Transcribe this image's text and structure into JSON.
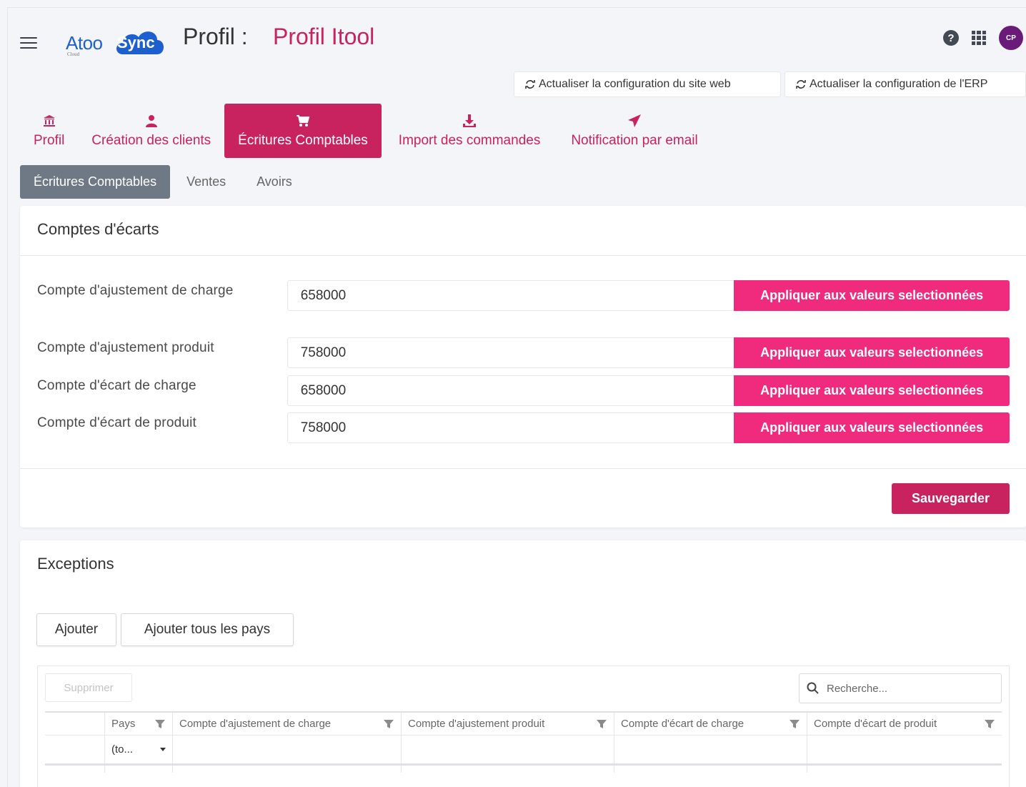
{
  "header": {
    "logo_text_1": "Atoo",
    "logo_text_2": "Sync",
    "logo_small": "Cloud",
    "title_label": "Profil :",
    "title_value": "Profil Itool",
    "avatar_initials": "CP",
    "help_glyph": "?"
  },
  "actions": {
    "refresh_site": "Actualiser la configuration du site web",
    "refresh_erp": "Actualiser la configuration de l'ERP"
  },
  "main_tabs": [
    {
      "label": "Profil",
      "icon": "bank-icon"
    },
    {
      "label": "Création des clients",
      "icon": "user-icon"
    },
    {
      "label": "Écritures Comptables",
      "icon": "cart-icon",
      "active": true
    },
    {
      "label": "Import des commandes",
      "icon": "download-icon"
    },
    {
      "label": "Notification par email",
      "icon": "send-icon"
    }
  ],
  "sub_tabs": [
    {
      "label": "Écritures Comptables",
      "active": true
    },
    {
      "label": "Ventes"
    },
    {
      "label": "Avoirs"
    }
  ],
  "comptes_card": {
    "title": "Comptes d'écarts",
    "rows": [
      {
        "label": "Compte d'ajustement de charge",
        "value": "658000",
        "button": "Appliquer aux valeurs selectionnées"
      },
      {
        "label": "Compte d'ajustement produit",
        "value": "758000",
        "button": "Appliquer aux valeurs selectionnées"
      },
      {
        "label": "Compte d'écart de charge",
        "value": "658000",
        "button": "Appliquer aux valeurs selectionnées"
      },
      {
        "label": "Compte d'écart de produit",
        "value": "758000",
        "button": "Appliquer aux valeurs selectionnées"
      }
    ],
    "save_label": "Sauvegarder"
  },
  "exceptions_card": {
    "title": "Exceptions",
    "add_label": "Ajouter",
    "add_all_label": "Ajouter tous les pays",
    "delete_label": "Supprimer",
    "search_placeholder": "Recherche...",
    "columns": [
      "",
      "Pays",
      "Compte d'ajustement de charge",
      "Compte d'ajustement produit",
      "Compte d'écart de charge",
      "Compte d'écart de produit"
    ],
    "filter_value": "(to..."
  },
  "colors": {
    "brand_primary": "#c8225f",
    "apply_button": "#f02a7d",
    "subtab_active": "#6f7885",
    "logo_blue": "#1e5fd0"
  }
}
